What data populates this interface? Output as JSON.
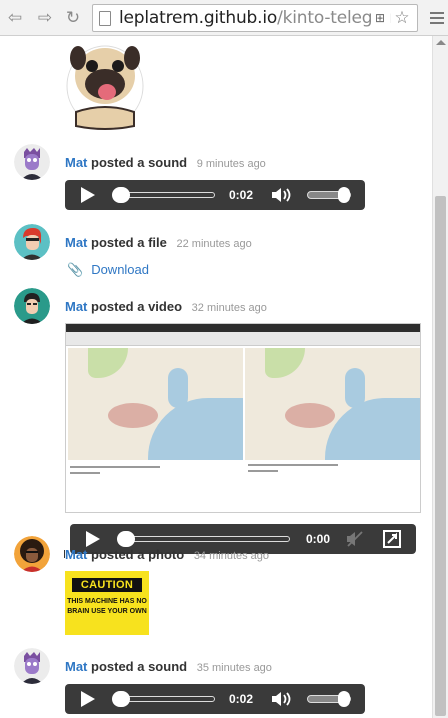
{
  "browser": {
    "url_host": "leplatrem.github.io",
    "url_path": "/kinto-telegram"
  },
  "feed": [
    {
      "type": "sound",
      "user": "Mat",
      "action": "posted a sound",
      "time": "9 minutes ago",
      "player_time": "0:02",
      "progress_fraction": 0.02,
      "volume_fraction": 0.85
    },
    {
      "type": "file",
      "user": "Mat",
      "action": "posted a file",
      "time": "22 minutes ago",
      "link_label": "Download"
    },
    {
      "type": "video",
      "user": "Mat",
      "action": "posted a video",
      "time": "32 minutes ago",
      "player_time": "0:00",
      "progress_fraction": 0.0
    },
    {
      "type": "photo",
      "user": "Mat",
      "action": "posted a photo",
      "time": "34 minutes ago",
      "photo_title": "CAUTION",
      "photo_text": "THIS MACHINE HAS NO BRAIN USE YOUR OWN"
    },
    {
      "type": "sound",
      "user": "Mat",
      "action": "posted a sound",
      "time": "35 minutes ago",
      "player_time": "0:02",
      "progress_fraction": 0.02,
      "volume_fraction": 0.85
    }
  ],
  "colors": {
    "link": "#2f77c4",
    "player_bg": "#3a3a3a",
    "caution_yellow": "#f7e21e"
  }
}
